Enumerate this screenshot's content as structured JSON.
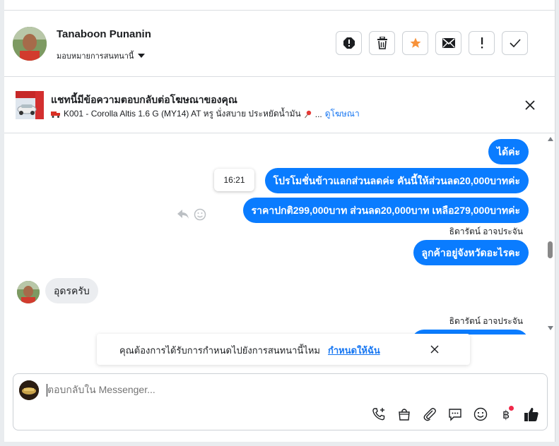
{
  "header": {
    "customer_name": "Tanaboon Punanin",
    "assign_label": "มอบหมายการสนทนานี้",
    "actions": [
      "spam-icon",
      "trash-icon",
      "star-icon",
      "mail-icon",
      "alert-icon",
      "check-icon"
    ]
  },
  "ad": {
    "title": "แชทนี้มีข้อความตอบกลับต่อโฆษณาของคุณ",
    "subtitle": "K001 - Corolla Altis 1.6 G (MY14) AT หรู นั่งสบาย ประหยัดน้ำมัน",
    "ellipsis": "...",
    "view_ad": "ดูโฆษณา"
  },
  "messages": {
    "m1": "ได้ค่ะ",
    "m2": "โปรโมชั่นข้าวแลกส่วนลดค่ะ คันนี้ให้ส่วนลด20,000บาทค่ะ",
    "m3": "ราคาปกติ299,000บาท ส่วนลด20,000บาท เหลือ279,000บาทค่ะ",
    "sender1": "ธิดารัตน์ อาจประจัน",
    "m4": "ลูกค้าอยู่จังหวัดอะไรคะ",
    "m5": "อุดรครับ",
    "sender2": "ธิดารัตน์ อาจประจัน",
    "tooltip_time": "16:21"
  },
  "banner": {
    "text": "คุณต้องการได้รับการกำหนดไปยังการสนทนานี้ไหม",
    "link": "กำหนดให้ฉัน"
  },
  "composer": {
    "placeholder": "ตอบกลับใน Messenger...",
    "tools": [
      "phone-add-icon",
      "shopping-bag-icon",
      "attachment-icon",
      "chat-icon",
      "emoji-icon",
      "baht-icon",
      "like-icon"
    ]
  },
  "colors": {
    "accent": "#0a7cff",
    "link": "#1877f2",
    "star": "#f7923a"
  }
}
